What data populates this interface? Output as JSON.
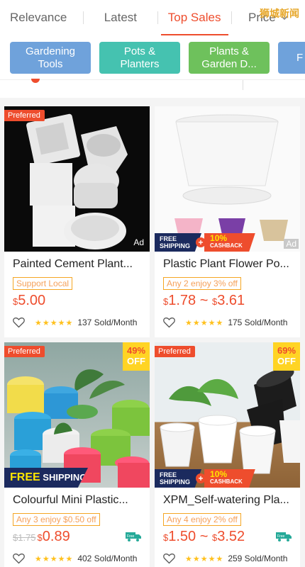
{
  "sort": {
    "tabs": [
      "Relevance",
      "Latest",
      "Top Sales",
      "Price"
    ],
    "active": "Top Sales"
  },
  "watermark": "狮城新闻",
  "categories": [
    {
      "label": "Gardening Tools",
      "color": "#6fa2db"
    },
    {
      "label": "Pots & Planters",
      "color": "#45c2b0"
    },
    {
      "label": "Plants & Garden D...",
      "color": "#6ec15c"
    },
    {
      "label": "F",
      "color": "#6fa2db"
    }
  ],
  "colors": {
    "accent": "#ee4d2d",
    "star": "#ffc11e",
    "free_shipping": "#1b2a5e"
  },
  "products": [
    {
      "name": "Painted Cement Plant...",
      "preferred": "Preferred",
      "badge": "Support Local",
      "price": "5.00",
      "currency": "$",
      "sold": "137 Sold/Month",
      "rating": 4.5,
      "ad": "Ad"
    },
    {
      "name": "Plastic Plant Flower Po...",
      "badge": "Any 2 enjoy 3% off",
      "price_low": "1.78",
      "price_high": "3.61",
      "currency": "$",
      "sold": "175 Sold/Month",
      "rating": 4.5,
      "ad": "Ad",
      "promo": {
        "free": "FREE",
        "shipping": "SHIPPING",
        "pct": "10%",
        "cashback": "CASHBACK"
      }
    },
    {
      "name": "Colourful Mini Plastic...",
      "preferred": "Preferred",
      "discount": "49%",
      "off": "OFF",
      "badge": "Any 3 enjoy $0.50 off",
      "old_price": "$1.75",
      "price": "0.89",
      "currency": "$",
      "sold": "402 Sold/Month",
      "rating": 4.5,
      "promo_wide": {
        "free": "FREE",
        "shipping": "SHIPPING"
      },
      "free_label": "Free"
    },
    {
      "name": "XPM_Self-watering Pla...",
      "preferred": "Preferred",
      "discount": "69%",
      "off": "OFF",
      "badge": "Any 4 enjoy 2% off",
      "price_low": "1.50",
      "price_high": "3.52",
      "currency": "$",
      "sold": "259 Sold/Month",
      "rating": 4.5,
      "promo": {
        "free": "FREE",
        "shipping": "SHIPPING",
        "pct": "10%",
        "cashback": "CASHBACK"
      },
      "free_label": "Free"
    }
  ]
}
